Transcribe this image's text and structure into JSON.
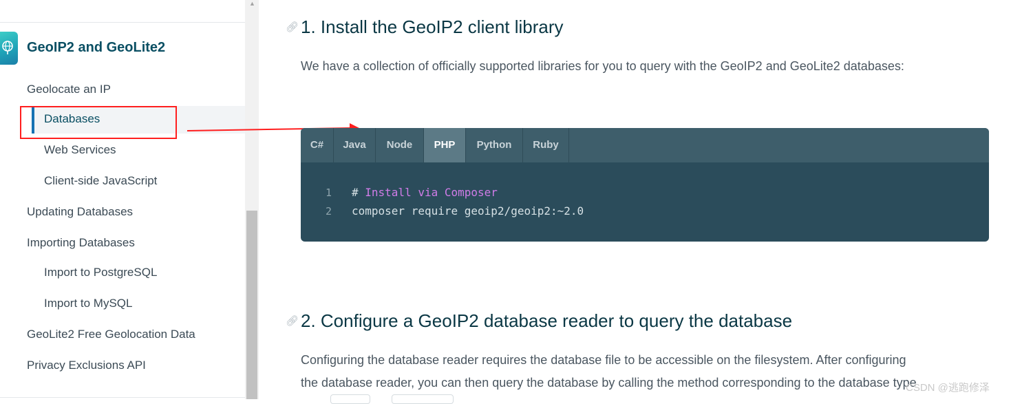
{
  "sidebar": {
    "title": "GeoIP2 and GeoLite2",
    "items": [
      {
        "label": "Geolocate an IP"
      },
      {
        "label": "Databases"
      },
      {
        "label": "Web Services"
      },
      {
        "label": "Client-side JavaScript"
      },
      {
        "label": "Updating Databases"
      },
      {
        "label": "Importing Databases"
      },
      {
        "label": "Import to PostgreSQL"
      },
      {
        "label": "Import to MySQL"
      },
      {
        "label": "GeoLite2 Free Geolocation Data"
      },
      {
        "label": "Privacy Exclusions API"
      }
    ],
    "active_item": "Databases"
  },
  "main": {
    "section1": {
      "heading": "1. Install the GeoIP2 client library",
      "paragraph": "We have a collection of officially supported libraries for you to query with the GeoIP2 and GeoLite2 databases:"
    },
    "code": {
      "tabs": [
        "C#",
        "Java",
        "Node",
        "PHP",
        "Python",
        "Ruby"
      ],
      "active_tab": "PHP",
      "lines": [
        {
          "num": "1",
          "prefix": "# ",
          "text": "Install via Composer"
        },
        {
          "num": "2",
          "prefix": "",
          "text": "composer require geoip2/geoip2:~2.0"
        }
      ]
    },
    "section2": {
      "heading": "2. Configure a GeoIP2 database reader to query the database",
      "paragraph_line1": "Configuring the database reader requires the database file to be accessible on the filesystem. After configuring",
      "paragraph_line2": "the database reader, you can then query the database by calling the method corresponding to the database type"
    }
  },
  "watermark": "CSDN @逃跑修泽",
  "colors": {
    "accent": "#1672b3",
    "heading": "#0a3744",
    "code_bg": "#2b4c5b",
    "tab_bar": "#3e5e6b",
    "tab_active": "#5c7a86",
    "comment_keyword": "#d07ce8",
    "annotation": "#ff1e1e"
  },
  "icons": {
    "logo": "globe-location-icon",
    "heading_link": "link-icon"
  }
}
